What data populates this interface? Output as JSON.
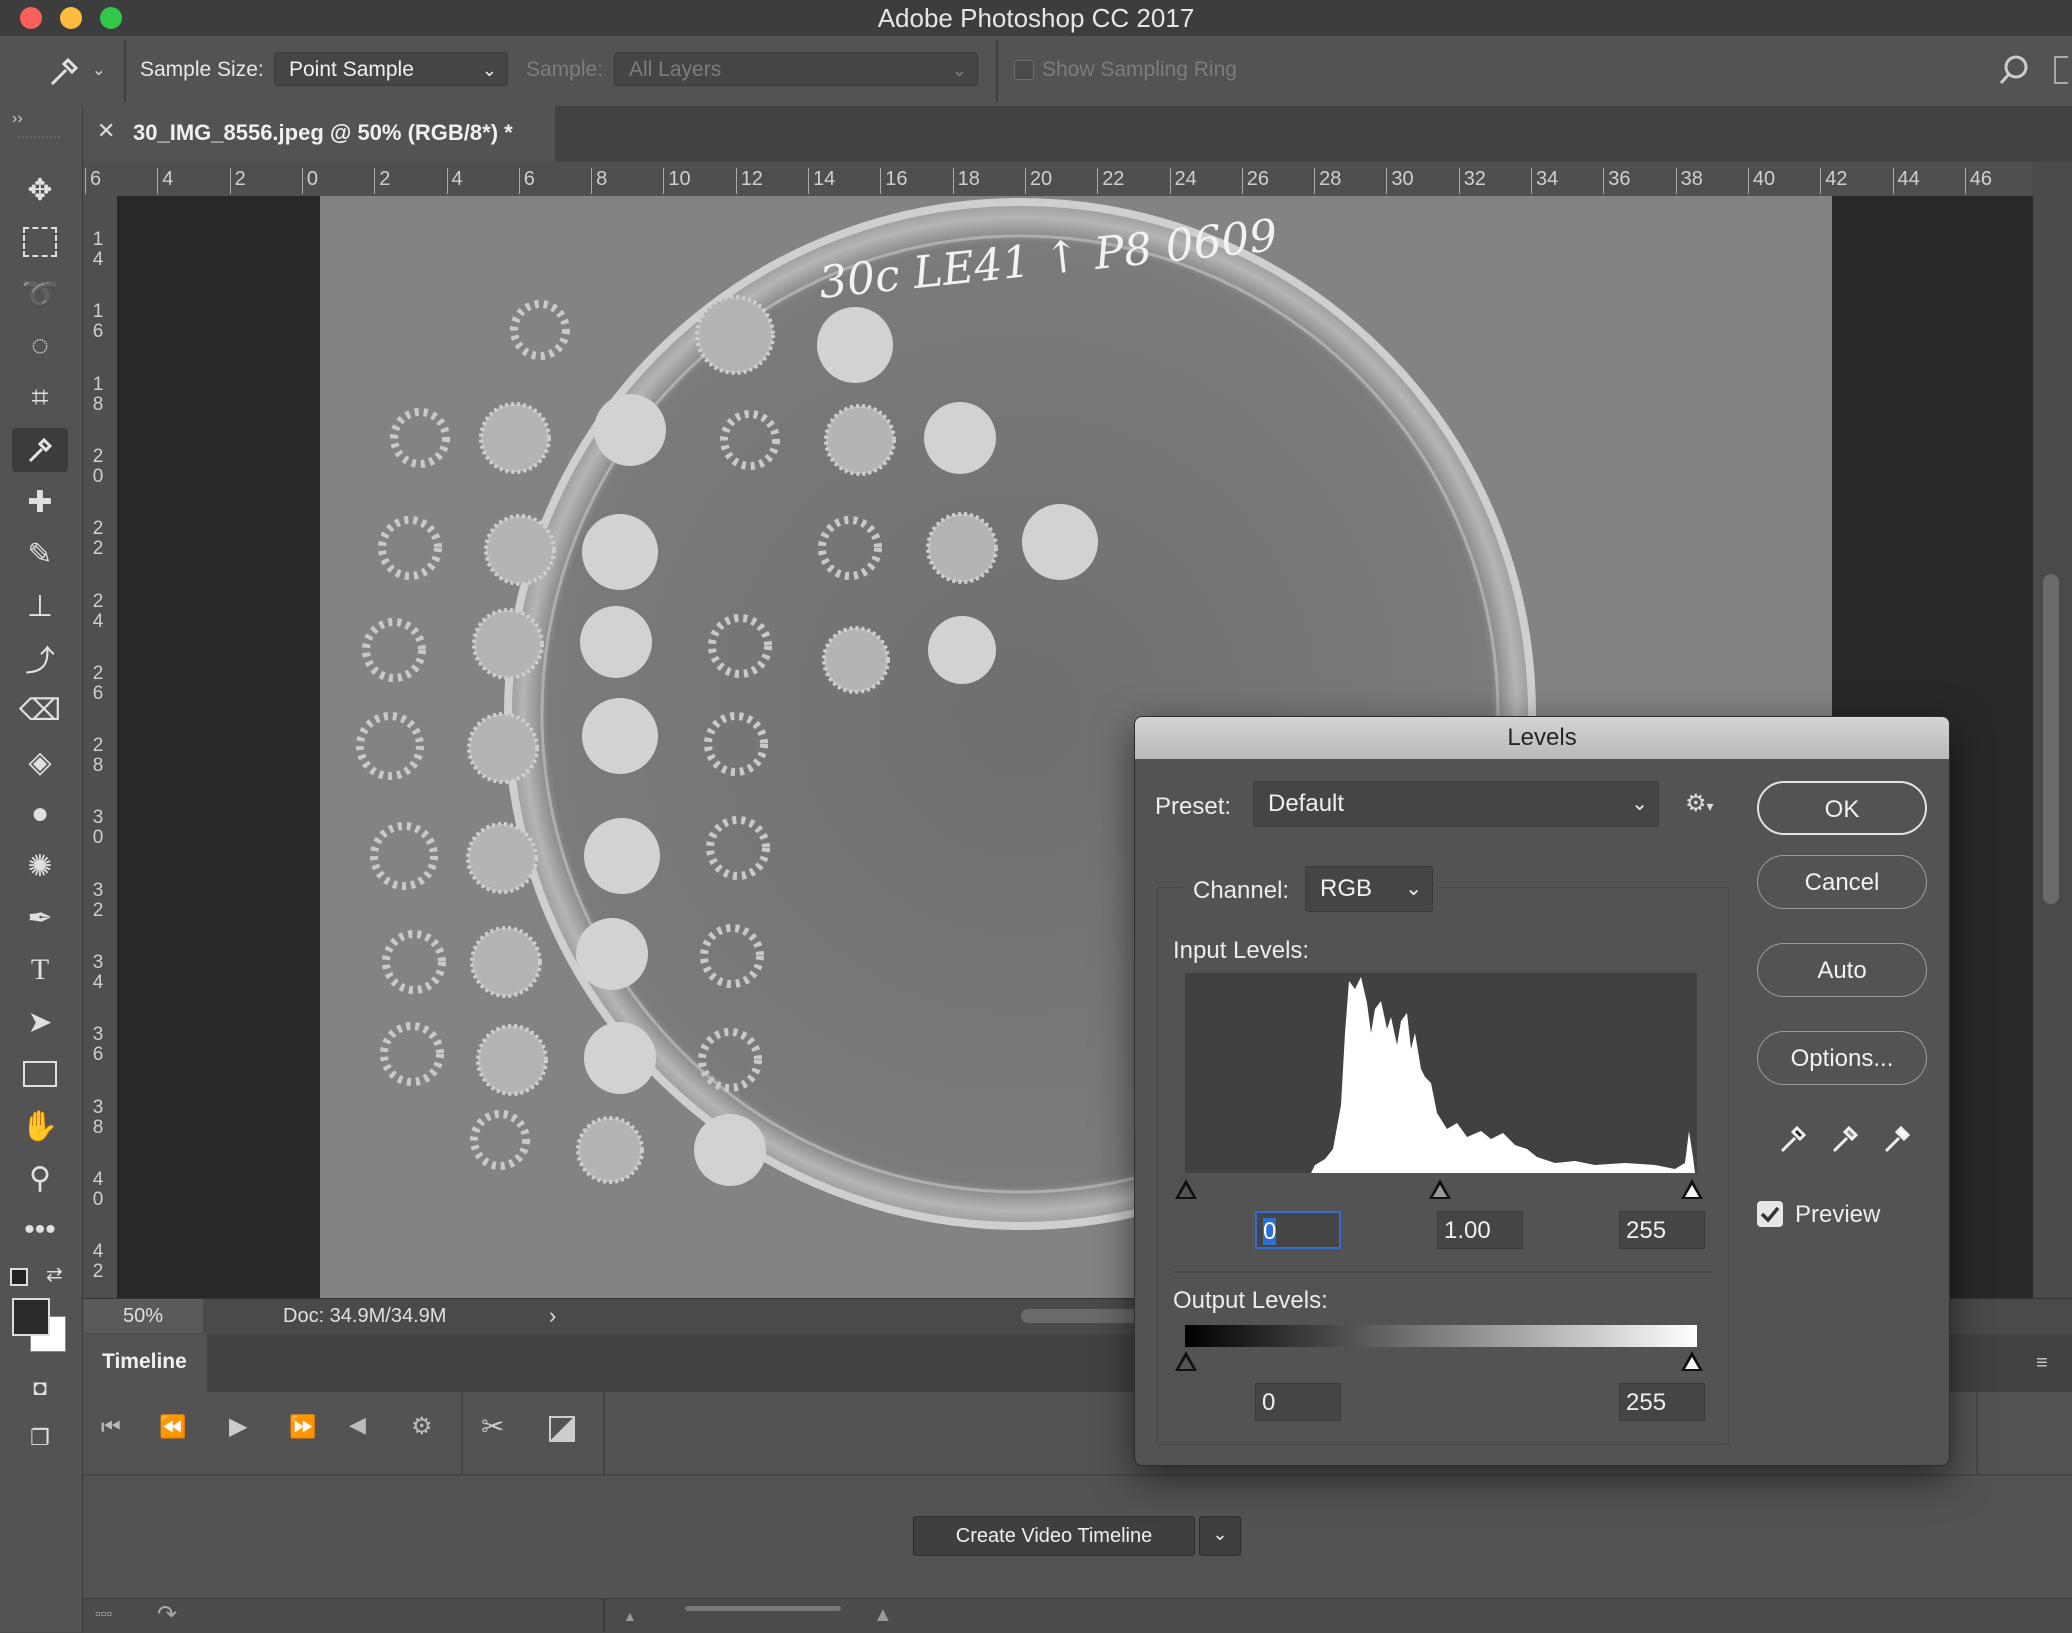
{
  "app": {
    "title": "Adobe Photoshop CC 2017"
  },
  "options_bar": {
    "sample_size_label": "Sample Size:",
    "sample_size_value": "Point Sample",
    "sample_label": "Sample:",
    "sample_value": "All Layers",
    "sampling_ring_label": "Show Sampling Ring"
  },
  "document": {
    "tab_title": "30_IMG_8556.jpeg @ 50% (RGB/8*) *",
    "plate_label": "30c LE41 ↑ P8 0609",
    "hruler_ticks": [
      "6",
      "4",
      "2",
      "0",
      "2",
      "4",
      "6",
      "8",
      "10",
      "12",
      "14",
      "16",
      "18",
      "20",
      "22",
      "24",
      "26",
      "28",
      "30",
      "32",
      "34",
      "36",
      "38",
      "40",
      "42",
      "44",
      "46"
    ],
    "vruler_ticks": [
      "14",
      "16",
      "18",
      "20",
      "22",
      "24",
      "26",
      "28",
      "30",
      "32",
      "34",
      "36",
      "38",
      "40",
      "42"
    ]
  },
  "status": {
    "zoom": "50%",
    "doc_size": "Doc: 34.9M/34.9M"
  },
  "timeline": {
    "tab_label": "Timeline",
    "create_button": "Create Video Timeline"
  },
  "levels_dialog": {
    "title": "Levels",
    "preset_label": "Preset:",
    "preset_value": "Default",
    "channel_label": "Channel:",
    "channel_value": "RGB",
    "input_levels_label": "Input Levels:",
    "input_black": "0",
    "input_gamma": "1.00",
    "input_white": "255",
    "output_levels_label": "Output Levels:",
    "output_black": "0",
    "output_white": "255",
    "ok_label": "OK",
    "cancel_label": "Cancel",
    "auto_label": "Auto",
    "options_label": "Options...",
    "preview_label": "Preview",
    "preview_checked": true
  },
  "colors": {
    "ok_border": "#e2e2e2",
    "select_highlight": "#2f6fd2",
    "traffic_red": "#fc605b",
    "traffic_yellow": "#fdbc40",
    "traffic_green": "#34c84a"
  }
}
